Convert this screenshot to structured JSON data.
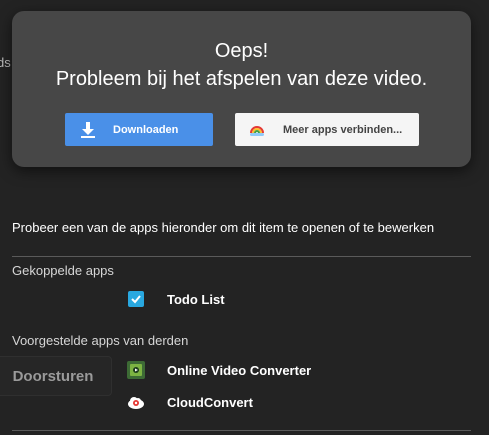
{
  "background": {
    "forward_button_label": "Doorsturen",
    "fragment_text": "ds"
  },
  "modal": {
    "title": "Oeps!",
    "subtitle": "Probleem bij het afspelen van deze video.",
    "download_label": "Downloaden",
    "connect_label": "Meer apps verbinden..."
  },
  "apps_panel": {
    "prompt": "Probeer een van de apps hieronder om dit item te openen of te bewerken",
    "connected_header": "Gekoppelde apps",
    "connected_apps": [
      {
        "label": "Todo List",
        "icon": "checkbox-icon"
      }
    ],
    "suggested_header": "Voorgestelde apps van derden",
    "suggested_apps": [
      {
        "label": "Online Video Converter",
        "icon": "video-converter-icon"
      },
      {
        "label": "CloudConvert",
        "icon": "cloudconvert-icon"
      }
    ]
  },
  "colors": {
    "background": "#232323",
    "modal": "#474747",
    "primary_button": "#4a90e8",
    "secondary_button": "#f5f5f5",
    "todo_icon": "#29a8e0"
  }
}
